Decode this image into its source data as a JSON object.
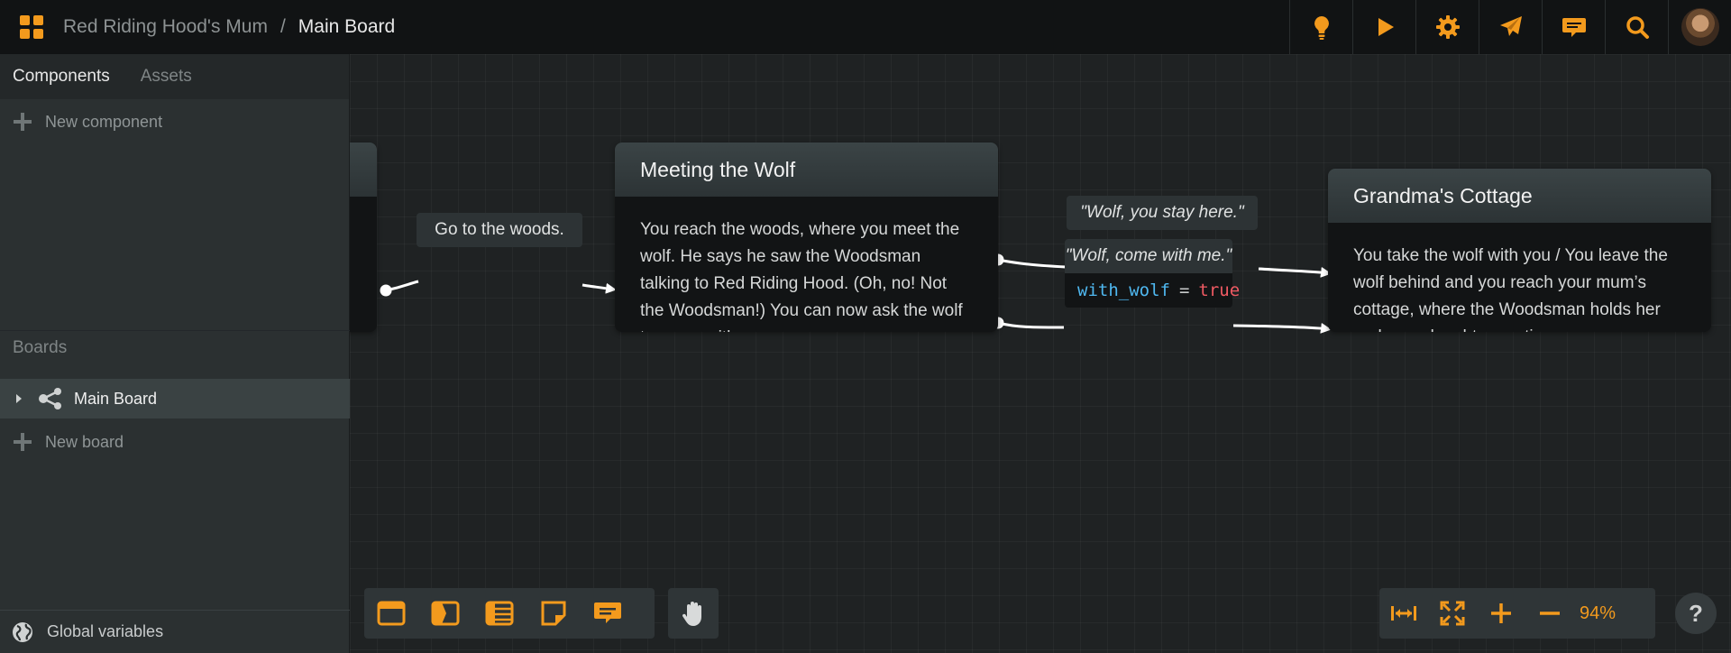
{
  "header": {
    "project": "Red Riding Hood's Mum",
    "separator": "/",
    "board": "Main Board",
    "actions": [
      "lightbulb-icon",
      "play-icon",
      "gear-icon",
      "paper-plane-icon",
      "chat-icon",
      "search-icon"
    ]
  },
  "sidebar": {
    "tabs": [
      "Components",
      "Assets"
    ],
    "new_component": "New component",
    "boards_heading": "Boards",
    "board_item": "Main Board",
    "new_board": "New board",
    "global_variables": "Global variables"
  },
  "nodes": {
    "meeting": {
      "title": "Meeting the Wolf",
      "body": "You reach the woods, where you meet the wolf. He says he saw the Woodsman talking to Red Riding Hood. (Oh, no! Not the Woodsman!) You can now ask the wolf to come with you."
    },
    "cottage": {
      "title": "Grandma's Cottage",
      "body": "You take the wolf with you / You leave the wolf behind and you reach your mum’s cottage, where the Woodsman holds her and your daughter captives."
    }
  },
  "connections": {
    "woods": "Go to the woods.",
    "stay": "\"Wolf, you stay here.\"",
    "come": "\"Wolf, come with me.\"",
    "condition": {
      "variable": "with_wolf",
      "operator": "=",
      "value": "true"
    }
  },
  "zoom": {
    "level": "94%"
  },
  "help": "?",
  "colors": {
    "accent": "#f39a1d",
    "variable": "#4fb8f0",
    "value": "#f05a63"
  }
}
